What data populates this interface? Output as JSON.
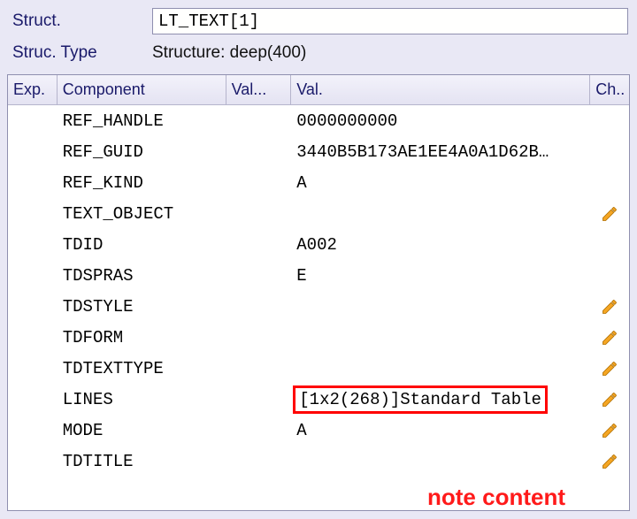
{
  "header": {
    "struct_label": "Struct.",
    "struct_value": "LT_TEXT[1]",
    "struc_type_label": "Struc. Type",
    "struc_type_value": "Structure: deep(400)"
  },
  "columns": {
    "exp": "Exp.",
    "component": "Component",
    "val1": "Val...",
    "val2": "Val.",
    "ch": "Ch.."
  },
  "rows": [
    {
      "component": "REF_HANDLE",
      "val": "0000000000",
      "pencil": false
    },
    {
      "component": "REF_GUID",
      "val": "3440B5B173AE1EE4A0A1D62B…",
      "pencil": false
    },
    {
      "component": "REF_KIND",
      "val": "A",
      "pencil": false
    },
    {
      "component": "TEXT_OBJECT",
      "val": "",
      "pencil": true
    },
    {
      "component": "TDID",
      "val": "A002",
      "pencil": false
    },
    {
      "component": "TDSPRAS",
      "val": "E",
      "pencil": false
    },
    {
      "component": "TDSTYLE",
      "val": "",
      "pencil": true
    },
    {
      "component": "TDFORM",
      "val": "",
      "pencil": true
    },
    {
      "component": "TDTEXTTYPE",
      "val": "",
      "pencil": true
    },
    {
      "component": "LINES",
      "val": "[1x2(268)]Standard Table",
      "pencil": true,
      "highlight": true
    },
    {
      "component": "MODE",
      "val": "A",
      "pencil": true
    },
    {
      "component": "TDTITLE",
      "val": "",
      "pencil": true
    }
  ],
  "annotation": "note content"
}
